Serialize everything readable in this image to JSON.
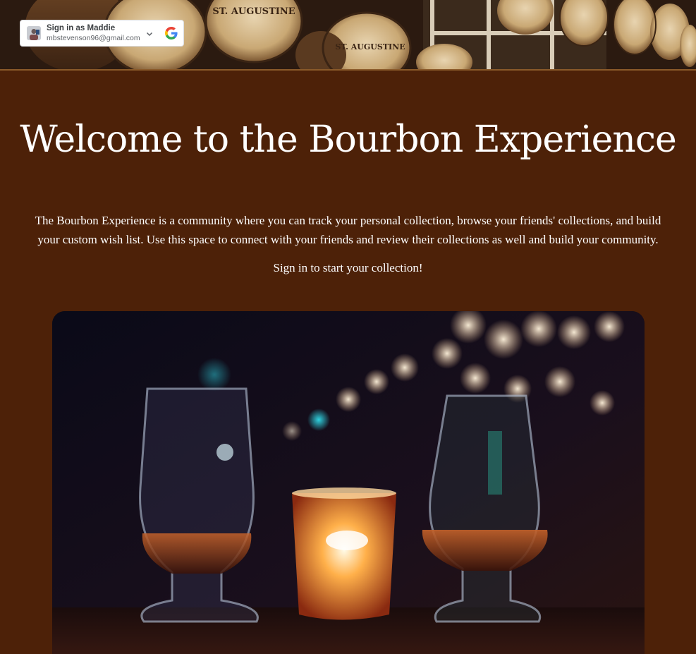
{
  "signin": {
    "name": "Sign in as Maddie",
    "email": "mbstevenson96@gmail.com"
  },
  "icons": {
    "avatar": "user-avatar-icon",
    "chevron": "chevron-down-icon",
    "google": "google-logo-icon"
  },
  "banner": {
    "barrel_label_1": "ST. AUGUSTINE",
    "barrel_label_2": "ST. AUGUSTINE"
  },
  "hero": {
    "title": "Welcome to the Bourbon Experience",
    "description": "The Bourbon Experience is a community where you can track your personal collection, browse your friends' collections, and build your custom wish list. Use this space to connect with your friends and review their collections as well and build your community.",
    "cta": "Sign in to start your collection!"
  },
  "colors": {
    "background": "#4d2108",
    "text": "#ffffff",
    "banner_border": "#8a5a2a"
  }
}
